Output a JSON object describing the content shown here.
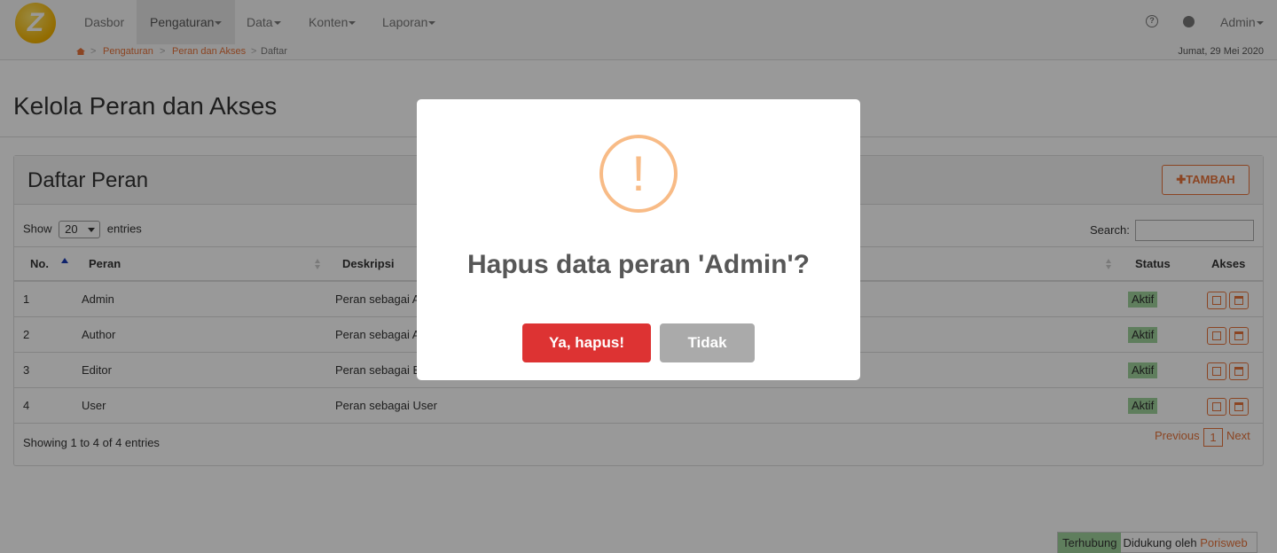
{
  "navbar": {
    "logo_letter": "Z",
    "items": [
      {
        "label": "Dasbor"
      },
      {
        "label": "Pengaturan"
      },
      {
        "label": "Data"
      },
      {
        "label": "Konten"
      },
      {
        "label": "Laporan"
      }
    ],
    "help_icon": "question-circle-icon",
    "globe_icon": "globe-icon",
    "user_label": "Admin"
  },
  "breadcrumb": {
    "home_icon": "home-icon",
    "items": [
      "Pengaturan",
      "Peran dan Akses",
      "Daftar"
    ],
    "separator": ">",
    "date": "Jumat, 29 Mei 2020"
  },
  "page": {
    "title": "Kelola Peran dan Akses"
  },
  "panel": {
    "title": "Daftar Peran",
    "add_button": "TAMBAH",
    "show_label": "Show",
    "entries_value": "20",
    "entries_label": "entries",
    "search_label": "Search:",
    "columns": [
      "No.",
      "Peran",
      "Deskripsi",
      "Status",
      "Akses"
    ],
    "rows": [
      {
        "no": "1",
        "peran": "Admin",
        "deskripsi": "Peran sebagai A",
        "status": "Aktif"
      },
      {
        "no": "2",
        "peran": "Author",
        "deskripsi": "Peran sebagai A",
        "status": "Aktif"
      },
      {
        "no": "3",
        "peran": "Editor",
        "deskripsi": "Peran sebagai E",
        "status": "Aktif"
      },
      {
        "no": "4",
        "peran": "User",
        "deskripsi": "Peran sebagai User",
        "status": "Aktif"
      }
    ],
    "showing": "Showing 1 to 4 of 4 entries",
    "pager": {
      "previous": "Previous",
      "current": "1",
      "next": "Next"
    }
  },
  "footer": {
    "connected": "Terhubung",
    "support": "Didukung oleh",
    "brand": "Porisweb"
  },
  "modal": {
    "icon": "warning-icon",
    "icon_glyph": "!",
    "title": "Hapus data peran 'Admin'?",
    "confirm": "Ya, hapus!",
    "cancel": "Tidak"
  },
  "colors": {
    "accent": "#e8743b",
    "confirm": "#dd3333",
    "cancel": "#aaaaaa",
    "status": "#9fd39b",
    "warning": "#f8bb86"
  }
}
